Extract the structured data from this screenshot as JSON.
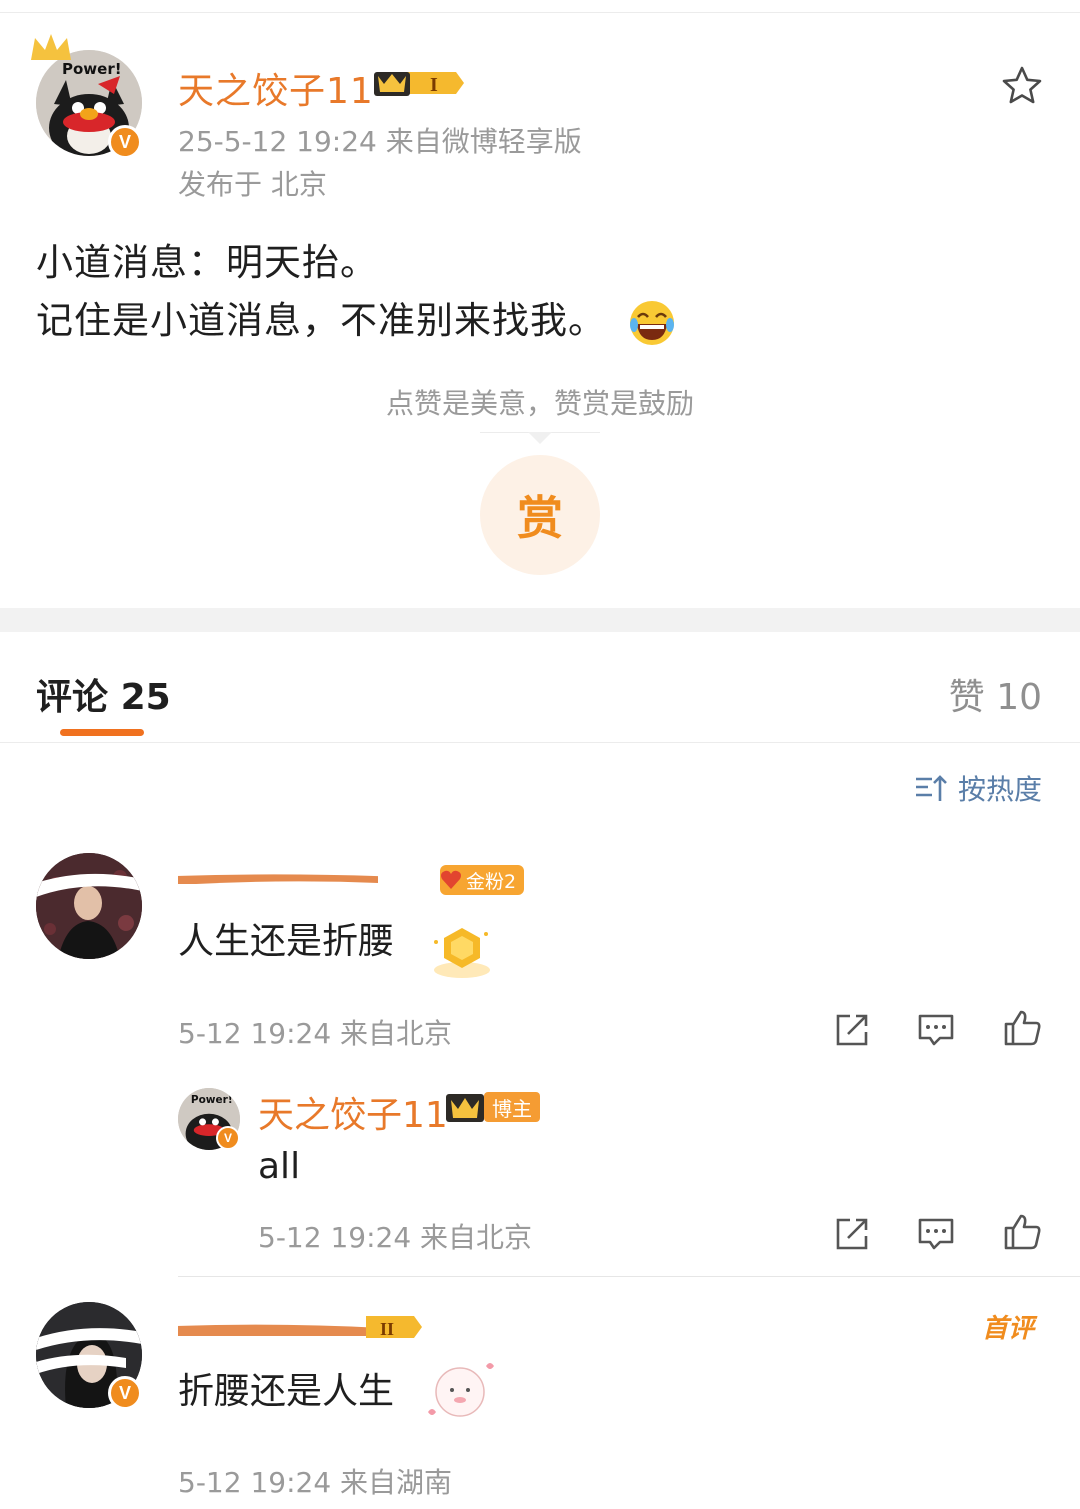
{
  "post": {
    "author": "天之饺子11",
    "level_badge": "I",
    "avatar_text": "Power!",
    "meta": "25-5-12 19:24  来自微博轻享版",
    "location": "发布于 北京",
    "lines": [
      "小道消息：明天抬。",
      "记住是小道消息，不准别来找我。"
    ],
    "reward_hint": "点赞是美意，赞赏是鼓励",
    "reward_label": "赏"
  },
  "tabs": {
    "comments_label": "评论",
    "comments_count": "25",
    "likes_label": "赞",
    "likes_count": "10"
  },
  "sort": {
    "label": "按热度"
  },
  "comments": [
    {
      "fan_badge": "金粉2",
      "text": "人生还是折腰",
      "meta": "5-12 19:24  来自北京",
      "reply": {
        "author": "天之饺子11",
        "badge": "博主",
        "avatar_text": "Power!",
        "text": "all",
        "meta": "5-12 19:24  来自北京"
      }
    },
    {
      "level_badge": "II",
      "tag": "首评",
      "text": "折腰还是人生",
      "meta": "5-12 19:24  来自湖南"
    }
  ],
  "colors": {
    "accent": "#f0711f",
    "name": "#e8792a",
    "meta": "#9a9a9a",
    "link": "#5a7ea8"
  }
}
